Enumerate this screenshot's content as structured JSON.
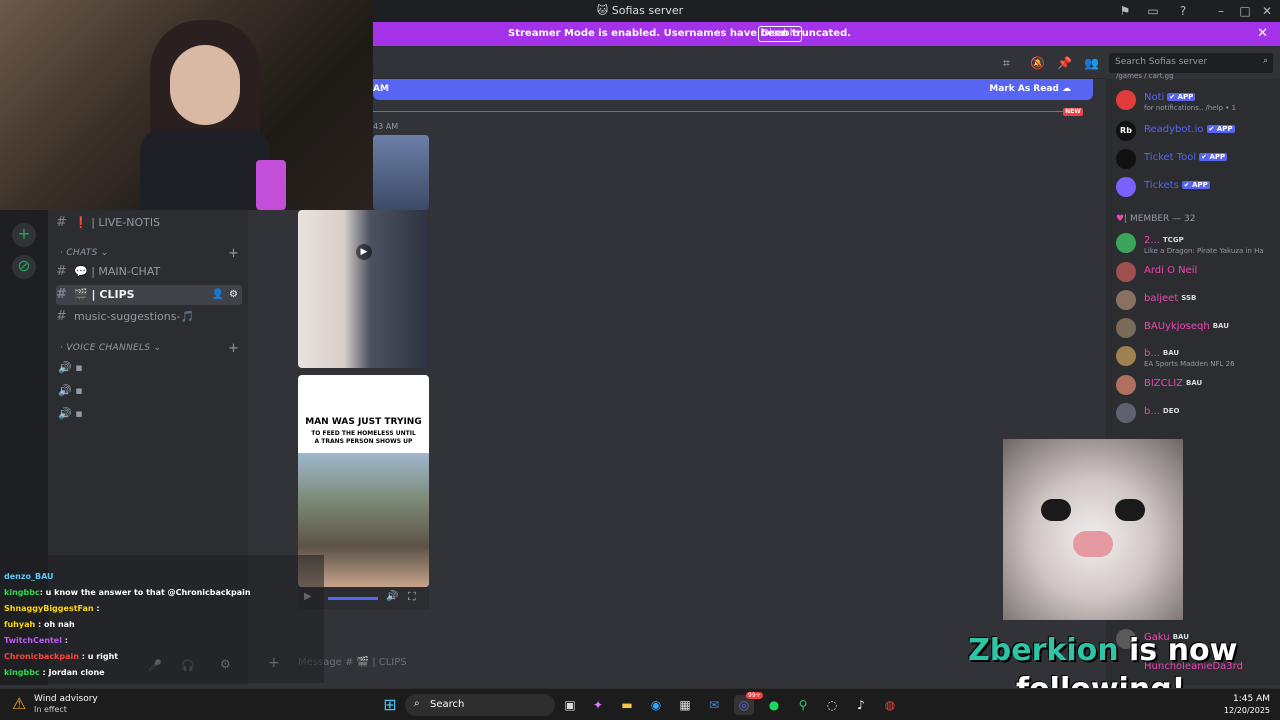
{
  "window": {
    "title": "Sofias server"
  },
  "banner": {
    "text": "Streamer Mode is enabled. Usernames have been truncated.",
    "disable_label": "Disable"
  },
  "header": {
    "search_placeholder": "Search Sofias server"
  },
  "unread": {
    "left_text": "AM",
    "mark_read_label": "Mark As Read",
    "new_badge": "NEW",
    "time": "43 AM"
  },
  "sidebar": {
    "channels_top": [
      {
        "label": "| LIVE-NOTIS",
        "emoji": "❗"
      }
    ],
    "chats_category": "· CHATS ⌄",
    "chats": [
      {
        "label": "| MAIN-CHAT",
        "emoji": "💬",
        "active": false
      },
      {
        "label": "| CLIPS",
        "emoji": "🎬",
        "active": true
      },
      {
        "label": "music-suggestions-",
        "emoji": "🎵",
        "active": false
      }
    ],
    "voice_category": "· VOICE CHANNELS ⌄"
  },
  "media": {
    "meme_text_line1": "MAN WAS JUST TRYING",
    "meme_text_line2": "TO FEED THE HOMELESS UNTIL",
    "meme_text_line3": "A TRANS PERSON SHOWS UP"
  },
  "message_box": {
    "placeholder": "Message # 🎬 | CLIPS"
  },
  "members": {
    "apps": [
      {
        "name": "Noti",
        "tag": "✔ APP",
        "sub": "for notifications.. /help • 1",
        "color": "#5865f2",
        "avatar": "#e23b3b"
      },
      {
        "name": "Readybot.io",
        "tag": "✔ APP",
        "sub": "",
        "color": "#5865f2",
        "avatar": "#1e1f22"
      },
      {
        "name": "Ticket Tool",
        "tag": "✔ APP",
        "sub": "",
        "color": "#5865f2",
        "avatar": "#1e1f22"
      },
      {
        "name": "Tickets",
        "tag": "✔ APP",
        "sub": "",
        "color": "#5865f2",
        "avatar": "#7b61ff"
      }
    ],
    "member_header": "| MEMBER — 32",
    "list": [
      {
        "name": "2...",
        "tag": "TCGP",
        "sub": "Like a Dragon: Pirate Yakuza in Ha",
        "color": "#f047b4",
        "avatar": "#3ba55c"
      },
      {
        "name": "Ardi O Neil",
        "tag": "",
        "sub": "",
        "color": "#f047b4",
        "avatar": "#a05050"
      },
      {
        "name": "baljeet",
        "tag": "SSB",
        "sub": "",
        "color": "#f047b4",
        "avatar": "#8a7060"
      },
      {
        "name": "BAUykjoseqh",
        "tag": "BAU",
        "sub": "",
        "color": "#f047b4",
        "avatar": "#7a6a5a"
      },
      {
        "name": "b...",
        "tag": "BAU",
        "sub": "EA Sports Madden NFL 26",
        "color": "#f047b4",
        "avatar": "#a08050"
      },
      {
        "name": "BIZCLIZ",
        "tag": "BAU",
        "sub": "",
        "color": "#f047b4",
        "avatar": "#b07060"
      },
      {
        "name": "b...",
        "tag": "DEO",
        "sub": "",
        "color": "#f047b4",
        "avatar": "#606070"
      }
    ],
    "bottom": [
      {
        "name": "Gaku",
        "tag": "BAU"
      },
      {
        "name": "HuncholeanieDa3rd",
        "tag": ""
      }
    ]
  },
  "chat": [
    {
      "user": "denzo_BAU",
      "msg": "",
      "color": "#5ac8fa"
    },
    {
      "user": "kingbbc",
      "msg": ": u know the answer to that @Chronicbackpain",
      "color": "#32d74b"
    },
    {
      "user": "ShnaggyBiggestFan",
      "msg": ":",
      "color": "#ffd60a"
    },
    {
      "user": "fuhyah",
      "msg": ": oh nah",
      "color": "#ffd60a"
    },
    {
      "user": "TwitchCentel",
      "msg": ":",
      "color": "#bf5af2"
    },
    {
      "user": "Chronicbackpain",
      "msg": ": u right",
      "color": "#ff453a"
    },
    {
      "user": "kingbbc",
      "msg": ": Jordan clone",
      "color": "#32d74b"
    }
  ],
  "follow": {
    "name": "Zberkion",
    "text1": " is now",
    "text2": "following!"
  },
  "taskbar": {
    "weather_title": "Wind advisory",
    "weather_sub": "In effect",
    "search_label": "Search",
    "time": "1:45 AM",
    "date": "12/20/2025",
    "discord_badge": "99+"
  }
}
